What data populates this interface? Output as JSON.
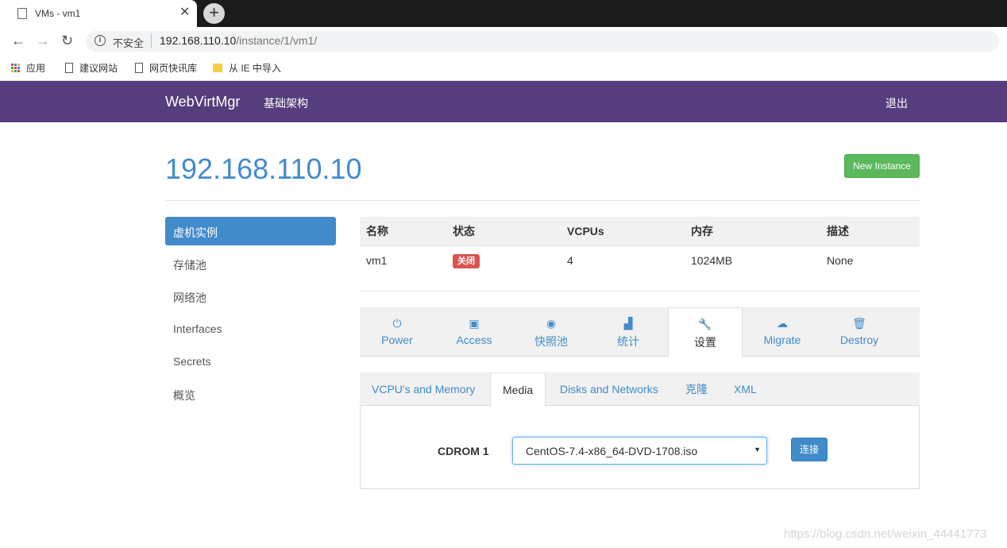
{
  "browser": {
    "tab_title": "VMs - vm1",
    "close_glyph": "✕",
    "new_tab_glyph": "+",
    "back_glyph": "←",
    "forward_glyph": "→",
    "reload_glyph": "↻",
    "security_label": "不安全",
    "url_host": "192.168.110.10",
    "url_path": "/instance/1/vm1/",
    "bookmarks": [
      "应用",
      "建议网站",
      "网页快讯库",
      "从 IE 中导入"
    ]
  },
  "navbar": {
    "brand": "WebVirtMgr",
    "infra": "基础架构",
    "logout": "退出",
    "color": "#563d7c"
  },
  "header": {
    "title": "192.168.110.10",
    "new_instance": "New Instance"
  },
  "sidebar": {
    "items": [
      {
        "label": "虚机实例",
        "active": true
      },
      {
        "label": "存储池"
      },
      {
        "label": "网络池"
      },
      {
        "label": "Interfaces"
      },
      {
        "label": "Secrets"
      },
      {
        "label": "概览"
      }
    ]
  },
  "instance_table": {
    "headers": [
      "名称",
      "状态",
      "VCPUs",
      "内存",
      "描述"
    ],
    "row": {
      "name": "vm1",
      "status": "关闭",
      "vcpus": "4",
      "memory": "1024MB",
      "description": "None"
    }
  },
  "action_tabs": [
    {
      "icon": "power-icon",
      "glyph": "⏻",
      "label": "Power"
    },
    {
      "icon": "briefcase-icon",
      "glyph": "▣",
      "label": "Access"
    },
    {
      "icon": "camera-icon",
      "glyph": "◉",
      "label": "快照池"
    },
    {
      "icon": "stats-icon",
      "glyph": "▟",
      "label": "统计"
    },
    {
      "icon": "wrench-icon",
      "glyph": "🔧",
      "label": "设置",
      "active": true
    },
    {
      "icon": "cloud-upload-icon",
      "glyph": "☁",
      "label": "Migrate"
    },
    {
      "icon": "trash-icon",
      "glyph": "🗑",
      "label": "Destroy"
    }
  ],
  "settings_tabs": [
    {
      "label": "VCPU's and Memory"
    },
    {
      "label": "Media",
      "active": true
    },
    {
      "label": "Disks and Networks"
    },
    {
      "label": "克隆"
    },
    {
      "label": "XML"
    }
  ],
  "media": {
    "cdrom_label": "CDROM 1",
    "selected_iso": "CentOS-7.4-x86_64-DVD-1708.iso",
    "connect_label": "连接"
  },
  "watermark": "https://blog.csdn.net/weixin_44441773",
  "colors": {
    "primary": "#428bca",
    "success": "#5cb85c",
    "danger": "#d9534f"
  }
}
